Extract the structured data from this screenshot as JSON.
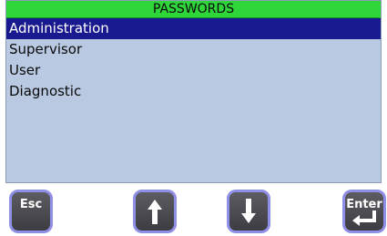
{
  "title": "PASSWORDS",
  "list": {
    "items": [
      {
        "label": "Administration",
        "selected": true
      },
      {
        "label": "Supervisor",
        "selected": false
      },
      {
        "label": "User",
        "selected": false
      },
      {
        "label": "Diagnostic",
        "selected": false
      }
    ]
  },
  "buttons": {
    "esc_label": "Esc",
    "up_icon": "arrow-up-icon",
    "down_icon": "arrow-down-icon",
    "enter_label": "Enter",
    "enter_icon": "enter-return-icon"
  },
  "colors": {
    "title_bar": "#2fd63a",
    "screen_bg": "#b8c9e1",
    "selected_bg": "#1a1a90",
    "key_border": "#8f8fe6"
  }
}
